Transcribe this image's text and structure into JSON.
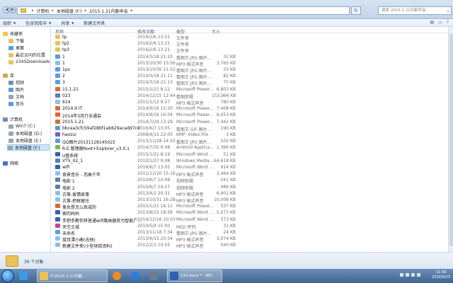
{
  "address": {
    "crumbs": [
      "计算机",
      "本地磁盘 (F:)",
      "2015.1.21内勤早会"
    ],
    "search_placeholder": "搜索 2015.1.21内勤早会"
  },
  "toolbar": {
    "organize": "组织",
    "include": "包含到库中",
    "share": "共享",
    "new_folder": "新建文件夹"
  },
  "nav": {
    "favorites": "收藏夹",
    "downloads": "下载",
    "desktop": "桌面",
    "recent": "最近访问的位置",
    "dl2345": "2345Downloads",
    "libraries": "库",
    "videos": "视频",
    "pictures": "图片",
    "documents": "文档",
    "music": "音乐",
    "computer": "计算机",
    "c": "Win7 (C:)",
    "d": "本地磁盘 (D:)",
    "e": "本地磁盘 (E:)",
    "f": "本地磁盘 (F:)",
    "network": "网络"
  },
  "columns": {
    "name": "名称",
    "date": "修改日期",
    "type": "类型",
    "size": "大小"
  },
  "files": [
    {
      "name": "tp",
      "date": "2016/2/6 13:21",
      "type": "文件夹",
      "size": "",
      "color": "#e9c25b"
    },
    {
      "name": "tp2",
      "date": "2016/2/6 13:21",
      "type": "文件夹",
      "size": "",
      "color": "#e9c25b"
    },
    {
      "name": "tp3",
      "date": "2016/2/6 13:21",
      "type": "文件夹",
      "size": "",
      "color": "#e9c25b"
    },
    {
      "name": "1",
      "date": "2014/3/18 21:10",
      "type": "看图王 JPG 图片...",
      "size": "32 KB",
      "color": "#5d9be0"
    },
    {
      "name": "1",
      "date": "2013/10/30 15:56",
      "type": "MP3 格式声音",
      "size": "3,765 KB",
      "color": "#8cc0e8"
    },
    {
      "name": "1ps",
      "date": "2013/10/30 11:52",
      "type": "看图王 JPG 图片...",
      "size": "33 KB",
      "color": "#5d9be0"
    },
    {
      "name": "2",
      "date": "2014/3/18 21:11",
      "type": "看图王 JPG 图片...",
      "size": "82 KB",
      "color": "#5d9be0"
    },
    {
      "name": "3",
      "date": "2014/3/18 21:13",
      "type": "看图王 JPG 图片...",
      "size": "75 KB",
      "color": "#5d9be0"
    },
    {
      "name": "15.1.21",
      "date": "2015/1/21 8:12",
      "type": "Microsoft Power...",
      "size": "6,803 KB",
      "color": "#d86a3a"
    },
    {
      "name": "023",
      "date": "2014/12/15 12:44",
      "type": "看图剪辑",
      "size": "153,966 KB",
      "color": "#5b7fae"
    },
    {
      "name": "614",
      "date": "2011/1/12 9:27",
      "type": "MP3 格式声音",
      "size": "780 KB",
      "color": "#8cc0e8"
    },
    {
      "name": "2014.9 IT",
      "date": "2014/9/16 15:20",
      "type": "Microsoft Power...",
      "size": "7,408 KB",
      "color": "#d86a3a"
    },
    {
      "name": "2014年3月行业通会",
      "date": "2014/9/16 16:04",
      "type": "Microsoft Power...",
      "size": "6,053 KB",
      "color": "#d86a3a"
    },
    {
      "name": "2015.1.21",
      "date": "2014/7/29 13:29",
      "type": "Microsoft Power...",
      "size": "7,442 KB",
      "color": "#d86a3a"
    },
    {
      "name": "bbcea3cfc59af28bf1ab629acadd7cd",
      "date": "2016/6/7 13:05",
      "type": "看图王 GIF 图片...",
      "size": "190 KB",
      "color": "#5d9be0"
    },
    {
      "name": "haozui",
      "date": "2008/4/15 22:05",
      "type": "KMP -Video File",
      "size": "3 KB",
      "color": "#7a5fb8"
    },
    {
      "name": "QQ图片20131128145025",
      "date": "2013/11/28 14:50",
      "type": "看图王 JPG 图片...",
      "size": "102 KB",
      "color": "#5d9be0"
    },
    {
      "name": "R.E.管理器Root+Explorer_v3.0.1",
      "date": "2014/7/30 9:48",
      "type": "Android Applica...",
      "size": "1,366 KB",
      "color": "#78b84a"
    },
    {
      "name": "U盘系统",
      "date": "2015/1/21 8:19",
      "type": "Microsoft Word ...",
      "size": "51 KB",
      "color": "#2f62b0"
    },
    {
      "name": "VTS_02_1",
      "date": "2010/1/27 9:08",
      "type": "Windows Media...",
      "size": "64,618 KB",
      "color": "#5b7fae"
    },
    {
      "name": "wifi",
      "date": "2016/6/7 13:05",
      "type": "Microsoft Word ...",
      "size": "914 KB",
      "color": "#2f62b0"
    },
    {
      "name": "背景音乐 - 恋曲千年",
      "date": "2011/12/20 15:16",
      "type": "MP3 格式声音",
      "size": "3,464 KB",
      "color": "#8cc0e8"
    },
    {
      "name": "电影 1",
      "date": "2010/6/7 14:08",
      "type": "视频剪辑",
      "size": "241 KB",
      "color": "#5b7fae"
    },
    {
      "name": "电影 2",
      "date": "2010/6/7 14:27",
      "type": "视频剪辑",
      "size": "486 KB",
      "color": "#5b7fae"
    },
    {
      "name": "古筝-爱情故事",
      "date": "2013/4/2 20:31",
      "type": "MP3 格式声音",
      "size": "6,901 KB",
      "color": "#8cc0e8"
    },
    {
      "name": "古筝-把根留住",
      "date": "2013/10/31 16:28",
      "type": "MP3 格式声音",
      "size": "10,006 KB",
      "color": "#8cc0e8"
    },
    {
      "name": "美女是怎么炼成的",
      "date": "2015/1/21 16:11",
      "type": "Microsoft Power...",
      "size": "537 KB",
      "color": "#d86a3a"
    },
    {
      "name": "索的妈妈",
      "date": "2013/8/15 18:56",
      "type": "Microsoft Word ...",
      "size": "5,073 KB",
      "color": "#2f62b0"
    },
    {
      "name": "手把手教你将普通wifi路由器变为智能广...",
      "date": "2014/12/16 10:03",
      "type": "Microsoft Word ...",
      "size": "373 KB",
      "color": "#2f62b0"
    },
    {
      "name": "天空之城",
      "date": "2010/5/4 15:00",
      "type": "MIDI 序列",
      "size": "31 KB",
      "color": "#c44a8a"
    },
    {
      "name": "未命名",
      "date": "2013/11/18 7:34",
      "type": "看图王 JPG 图片...",
      "size": "24 KB",
      "color": "#5d9be0"
    },
    {
      "name": "旋月潭小曲(吉他)",
      "date": "2013/6/15 20:54",
      "type": "MP3 格式声音",
      "size": "3,074 KB",
      "color": "#8cc0e8"
    },
    {
      "name": "新建文件夹(小型项目资料)",
      "date": "2012/2/1 10:55",
      "type": "MP3 格式声音",
      "size": "540 KB",
      "color": "#8cc0e8"
    }
  ],
  "status": {
    "count": "36 个对象"
  },
  "taskbar": {
    "explorer": "F:\\2015.1.21内勤...",
    "word": "114.docx * - WP...",
    "time": "11:56",
    "date": "2018/9/23"
  }
}
